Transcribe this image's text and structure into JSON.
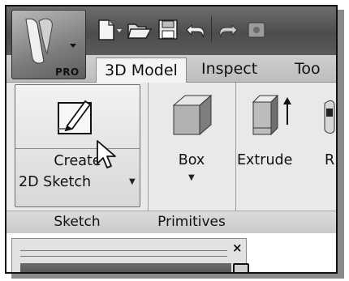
{
  "app": {
    "badge": "PRO"
  },
  "quick_access": {
    "icons": [
      "new-document-icon",
      "open-folder-icon",
      "save-icon",
      "undo-icon",
      "redo-icon",
      "app-options-icon"
    ]
  },
  "tabs": [
    {
      "label": "3D Model",
      "active": true
    },
    {
      "label": "Inspect",
      "active": false
    },
    {
      "label": "Too",
      "active": false
    }
  ],
  "ribbon": {
    "sketch_panel": {
      "button_line1": "Create",
      "button_line2": "2D Sketch",
      "title": "Sketch"
    },
    "primitives_panel": {
      "button_label": "Box",
      "title": "Primitives"
    },
    "create_panel": {
      "extrude_label": "Extrude",
      "next_label_partial": "R"
    }
  },
  "browser": {
    "close_glyph": "×"
  },
  "colors": {
    "ribbon_bg": "#e9e9e9",
    "tab_bar": "#c6c6c6",
    "title_bar": "#5a5a5a"
  }
}
